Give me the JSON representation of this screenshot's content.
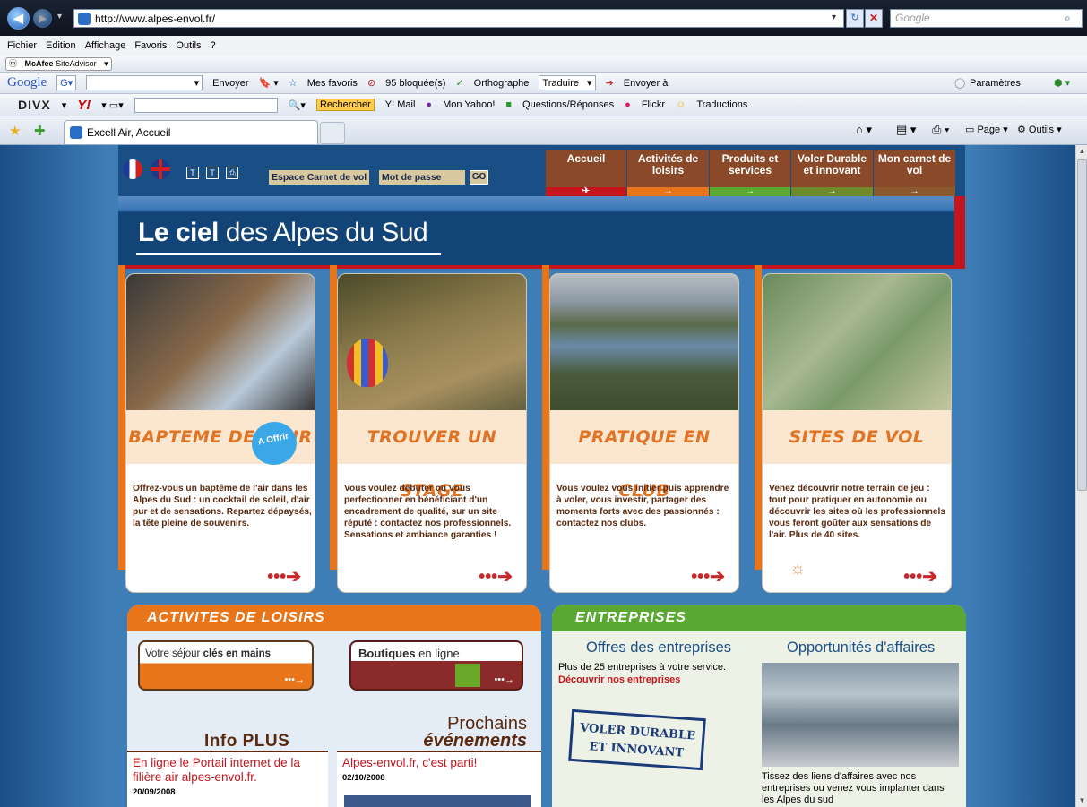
{
  "browser": {
    "url": "http://www.alpes-envol.fr/",
    "search_placeholder": "Google",
    "menu": [
      "Fichier",
      "Edition",
      "Affichage",
      "Favoris",
      "Outils",
      "?"
    ],
    "mcafee": "SiteAdvisor",
    "mcafee_brand": "McAfee",
    "google_toolbar": {
      "logo": "Google",
      "envoyer": "Envoyer",
      "favoris": "Mes favoris",
      "bloquees": "95 bloquée(s)",
      "orthographe": "Orthographe",
      "traduire": "Traduire",
      "envoyer_a": "Envoyer à",
      "parametres": "Paramètres"
    },
    "divx_toolbar": {
      "logo": "DIVX",
      "yahoo": "Y!",
      "rechercher": "Rechercher",
      "ymail": "Y! Mail",
      "mon_yahoo": "Mon Yahoo!",
      "questions": "Questions/Réponses",
      "flickr": "Flickr",
      "traductions": "Traductions"
    },
    "tab_title": "Excell Air, Accueil",
    "cmd": {
      "page": "Page",
      "outils": "Outils"
    }
  },
  "site": {
    "tools": {
      "login_label": "Espace Carnet de vol",
      "password_label": "Mot de passe",
      "go": "GO"
    },
    "nav": [
      {
        "label": "Accueil",
        "color": "#c4161c"
      },
      {
        "label": "Activités de loisirs",
        "color": "#e8751a"
      },
      {
        "label": "Produits et services",
        "color": "#5aa832"
      },
      {
        "label": "Voler Durable et innovant",
        "color": "#6f8a2a"
      },
      {
        "label": "Mon carnet de vol",
        "color": "#8a5a2e"
      }
    ],
    "banner": {
      "bold": "Le ciel",
      "rest": " des Alpes du Sud"
    },
    "cards": [
      {
        "title": "BAPTEME DE L'AIR",
        "badge": "A Offrir",
        "text": "Offrez-vous un baptême de l'air dans les Alpes du Sud : un cocktail de soleil, d'air pur et de sensations. Repartez dépaysés, la tête pleine de souvenirs."
      },
      {
        "title": "TROUVER UN STAGE",
        "text": "Vous voulez débuter ou vous perfectionner en bénéficiant d'un encadrement de qualité, sur un site réputé : contactez nos professionnels. Sensations et ambiance garanties !"
      },
      {
        "title": "PRATIQUE EN CLUB",
        "text": "Vous voulez vous initier puis apprendre à voler, vous investir, partager des moments forts avec des passionnés : contactez nos clubs."
      },
      {
        "title": "SITES DE VOL",
        "text": "Venez découvrir notre terrain de jeu : tout pour pratiquer en autonomie ou découvrir les sites où les professionnels vous feront goûter aux sensations de l'air. Plus de 40 sites."
      }
    ],
    "loisirs": {
      "header": "ACTIVITES DE LOISIRS",
      "sejour_pre": "Votre séjour ",
      "sejour_bold": "clés en mains",
      "boutiques_pre": "Boutiques ",
      "boutiques_post": "en ligne",
      "info_plus": "Info PLUS",
      "prochains": "Prochains",
      "evenements": "événements",
      "news1_title": "En ligne le Portail internet de la filière air alpes-envol.fr.",
      "news1_date": "20/09/2008",
      "news2_title": "Alpes-envol.fr, c'est parti!",
      "news2_date": "02/10/2008"
    },
    "entreprises": {
      "header": "ENTREPRISES",
      "offres_title": "Offres des entreprises",
      "offres_text": "Plus de 25 entreprises à votre service.",
      "offres_link": "Découvrir nos entreprises",
      "stamp_line1": "VOLER DURABLE",
      "stamp_line2": "ET INNOVANT",
      "opp_title": "Opportunités d'affaires",
      "opp_text": "Tissez des liens d'affaires avec nos entreprises ou venez vous implanter dans les Alpes du sud"
    }
  }
}
